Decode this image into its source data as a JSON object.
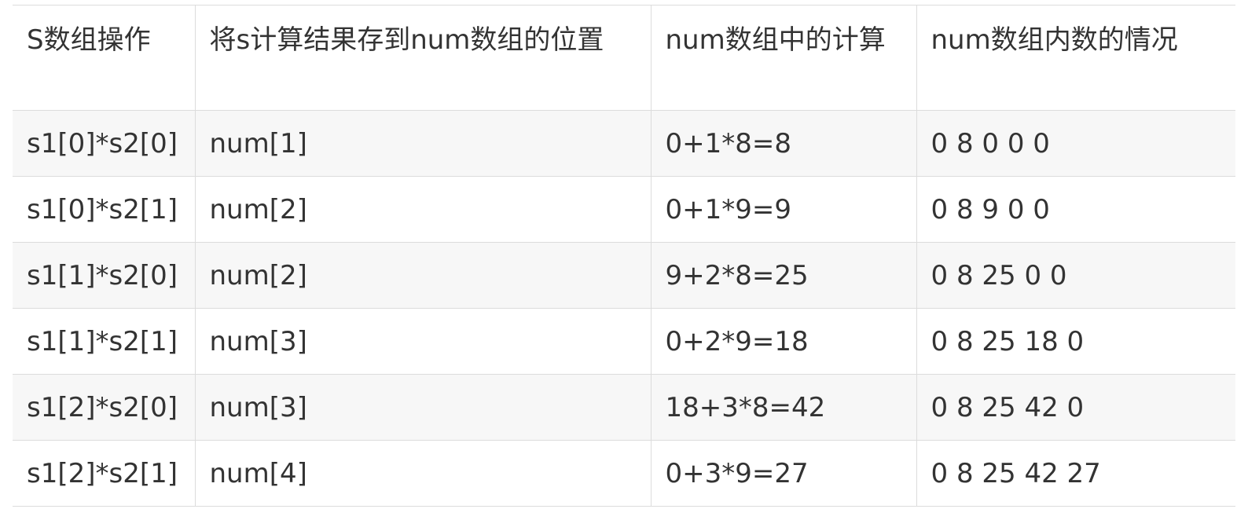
{
  "table": {
    "headers": [
      "S数组操作",
      "将s计算结果存到num数组的位置",
      "num数组中的计算",
      "num数组内数的情况"
    ],
    "rows": [
      [
        "s1[0]*s2[0]",
        "num[1]",
        "0+1*8=8",
        "0 8 0 0 0"
      ],
      [
        "s1[0]*s2[1]",
        "num[2]",
        "0+1*9=9",
        "0 8 9 0 0"
      ],
      [
        "s1[1]*s2[0]",
        "num[2]",
        "9+2*8=25",
        "0 8 25 0 0"
      ],
      [
        "s1[1]*s2[1]",
        "num[3]",
        "0+2*9=18",
        "0 8 25 18 0"
      ],
      [
        "s1[2]*s2[0]",
        "num[3]",
        "18+3*8=42",
        "0 8 25 42 0"
      ],
      [
        "s1[2]*s2[1]",
        "num[4]",
        "0+3*9=27",
        "0 8 25 42 27"
      ]
    ]
  },
  "colors": {
    "text": "#333333",
    "border": "#dcdcdc",
    "row_alt_bg": "#f7f7f7",
    "row_bg": "#ffffff"
  }
}
